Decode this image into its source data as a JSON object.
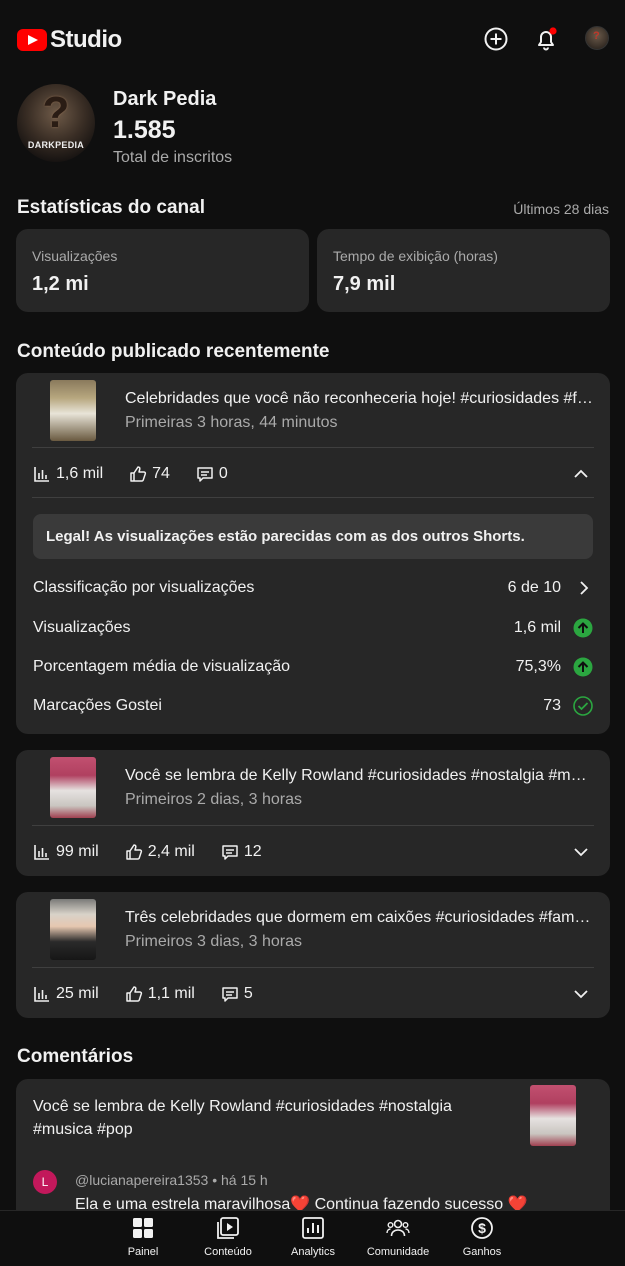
{
  "app": {
    "brand": "Studio"
  },
  "channel": {
    "name": "Dark Pedia",
    "subscribers": "1.585",
    "subscribers_label": "Total de inscritos",
    "avatar_text": "DARKPEDIA"
  },
  "stats": {
    "title": "Estatísticas do canal",
    "period": "Últimos 28 dias",
    "views_label": "Visualizações",
    "views_value": "1,2 mi",
    "watch_label": "Tempo de exibição (horas)",
    "watch_value": "7,9 mil"
  },
  "recent": {
    "title": "Conteúdo publicado recentemente",
    "videos": [
      {
        "title": "Celebridades que você não reconheceria hoje! #curiosidades #famosos",
        "subtitle": "Primeiras 3 horas, 44 minutos",
        "views": "1,6 mil",
        "likes": "74",
        "comments": "0",
        "expanded": true,
        "tip": "Legal! As visualizações estão parecidas com as dos outros Shorts.",
        "rows": [
          {
            "label": "Classificação por visualizações",
            "value": "6 de 10",
            "icon": "chevron-right-icon"
          },
          {
            "label": "Visualizações",
            "value": "1,6 mil",
            "icon": "arrow-up-circle-icon"
          },
          {
            "label": "Porcentagem média de visualização",
            "value": "75,3%",
            "icon": "arrow-up-circle-icon"
          },
          {
            "label": "Marcações Gostei",
            "value": "73",
            "icon": "check-circle-icon"
          }
        ]
      },
      {
        "title": "Você se lembra de Kelly Rowland #curiosidades #nostalgia #musica #pop",
        "subtitle": "Primeiros 2 dias, 3 horas",
        "views": "99 mil",
        "likes": "2,4 mil",
        "comments": "12",
        "expanded": false
      },
      {
        "title": "Três celebridades que dormem em caixões #curiosidades #famosos",
        "subtitle": "Primeiros 3 dias, 3 horas",
        "views": "25 mil",
        "likes": "1,1 mil",
        "comments": "5",
        "expanded": false
      }
    ]
  },
  "comments": {
    "title": "Comentários",
    "video_title": "Você se lembra de Kelly Rowland #curiosidades #nostalgia #musica #pop",
    "author_initial": "L",
    "author": "@lucianapereira1353 • há 15 h",
    "text": "Ela e uma estrela maravilhosa",
    "text_mid": " Continua fazendo sucesso ",
    "heart": "❤️"
  },
  "nav": {
    "items": [
      {
        "label": "Painel",
        "icon": "dashboard-icon"
      },
      {
        "label": "Conteúdo",
        "icon": "content-icon"
      },
      {
        "label": "Analytics",
        "icon": "analytics-icon"
      },
      {
        "label": "Comunidade",
        "icon": "community-icon"
      },
      {
        "label": "Ganhos",
        "icon": "earn-icon"
      }
    ]
  },
  "colors": {
    "accent_red": "#ff0000",
    "positive_green": "#2ba640",
    "card_bg": "#272727",
    "bg": "#0f0f0f"
  }
}
